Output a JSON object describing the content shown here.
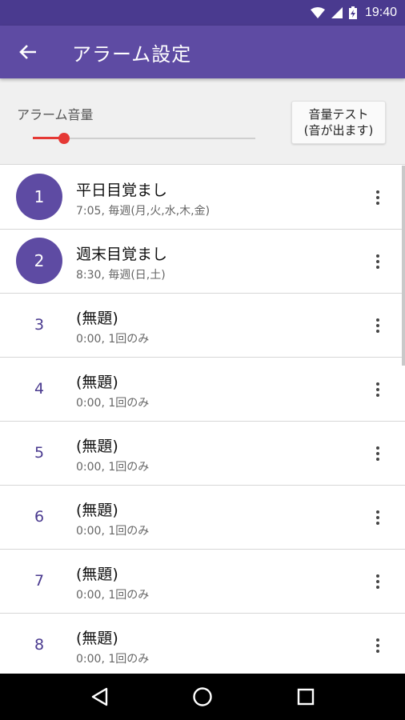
{
  "status_bar": {
    "time": "19:40"
  },
  "app_bar": {
    "title": "アラーム設定"
  },
  "volume": {
    "label": "アラーム音量",
    "level_fraction": 0.14
  },
  "test_button": {
    "line1": "音量テスト",
    "line2": "(音が出ます)"
  },
  "alarms": [
    {
      "number": "1",
      "name": "平日目覚まし",
      "detail": "7:05, 毎週(月,火,水,木,金)",
      "enabled": true
    },
    {
      "number": "2",
      "name": "週末目覚まし",
      "detail": "8:30, 毎週(日,土)",
      "enabled": true
    },
    {
      "number": "3",
      "name": "(無題)",
      "detail": "0:00, 1回のみ",
      "enabled": false
    },
    {
      "number": "4",
      "name": "(無題)",
      "detail": "0:00, 1回のみ",
      "enabled": false
    },
    {
      "number": "5",
      "name": "(無題)",
      "detail": "0:00, 1回のみ",
      "enabled": false
    },
    {
      "number": "6",
      "name": "(無題)",
      "detail": "0:00, 1回のみ",
      "enabled": false
    },
    {
      "number": "7",
      "name": "(無題)",
      "detail": "0:00, 1回のみ",
      "enabled": false
    },
    {
      "number": "8",
      "name": "(無題)",
      "detail": "0:00, 1回のみ",
      "enabled": false
    }
  ],
  "colors": {
    "primary": "#5e4ba3",
    "primary_dark": "#4a3a8f",
    "accent": "#e53935"
  },
  "icons": {
    "back": "arrow-left-icon",
    "menu": "more-vert-icon",
    "nav_back": "triangle-back-icon",
    "nav_home": "circle-home-icon",
    "nav_recent": "square-recent-icon"
  }
}
